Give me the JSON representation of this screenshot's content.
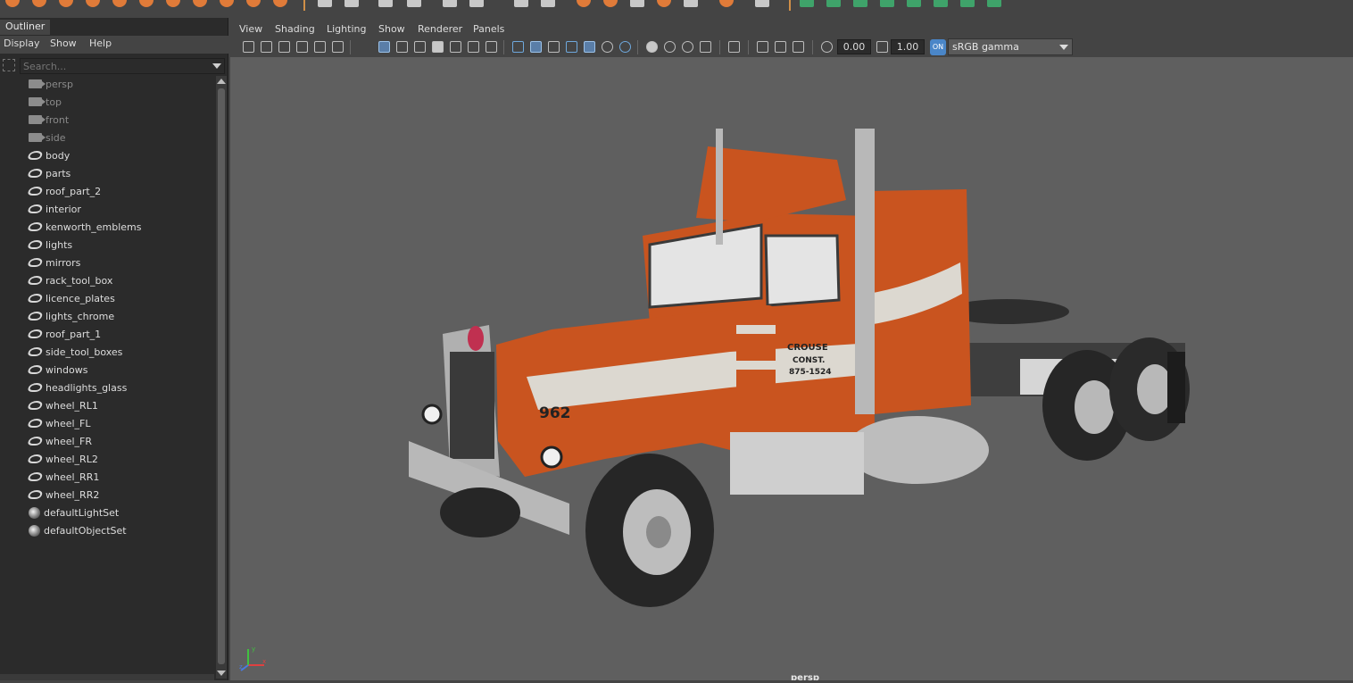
{
  "outliner": {
    "tab": "Outliner",
    "menu": [
      "Display",
      "Show",
      "Help"
    ],
    "search": {
      "placeholder": "Search..."
    },
    "items": [
      {
        "label": "persp",
        "icon": "camera-icon",
        "dim": true
      },
      {
        "label": "top",
        "icon": "camera-icon",
        "dim": true
      },
      {
        "label": "front",
        "icon": "camera-icon",
        "dim": true
      },
      {
        "label": "side",
        "icon": "camera-icon",
        "dim": true
      },
      {
        "label": "body",
        "icon": "mesh-group-icon"
      },
      {
        "label": "parts",
        "icon": "mesh-group-icon"
      },
      {
        "label": "roof_part_2",
        "icon": "mesh-group-icon"
      },
      {
        "label": "interior",
        "icon": "mesh-group-icon"
      },
      {
        "label": "kenworth_emblems",
        "icon": "mesh-group-icon"
      },
      {
        "label": "lights",
        "icon": "mesh-group-icon"
      },
      {
        "label": "mirrors",
        "icon": "mesh-group-icon"
      },
      {
        "label": "rack_tool_box",
        "icon": "mesh-group-icon"
      },
      {
        "label": "licence_plates",
        "icon": "mesh-group-icon"
      },
      {
        "label": "lights_chrome",
        "icon": "mesh-group-icon"
      },
      {
        "label": "roof_part_1",
        "icon": "mesh-group-icon"
      },
      {
        "label": "side_tool_boxes",
        "icon": "mesh-group-icon"
      },
      {
        "label": "windows",
        "icon": "mesh-group-icon"
      },
      {
        "label": "headlights_glass",
        "icon": "mesh-group-icon"
      },
      {
        "label": "wheel_RL1",
        "icon": "mesh-group-icon"
      },
      {
        "label": "wheel_FL",
        "icon": "mesh-group-icon"
      },
      {
        "label": "wheel_FR",
        "icon": "mesh-group-icon"
      },
      {
        "label": "wheel_RL2",
        "icon": "mesh-group-icon"
      },
      {
        "label": "wheel_RR1",
        "icon": "mesh-group-icon"
      },
      {
        "label": "wheel_RR2",
        "icon": "mesh-group-icon"
      },
      {
        "label": "defaultLightSet",
        "icon": "set-icon"
      },
      {
        "label": "defaultObjectSet",
        "icon": "set-icon"
      }
    ]
  },
  "viewport": {
    "menu": [
      "View",
      "Shading",
      "Lighting",
      "Show",
      "Renderer",
      "Panels"
    ],
    "exposure": "0.00",
    "gamma": "1.00",
    "colorspace": "sRGB gamma",
    "camera": "persp",
    "truck": {
      "cab_text": [
        "CROUSE",
        "CONST.",
        "875-1524"
      ],
      "hood_number": "962"
    },
    "colors": {
      "paint": "#c9541f",
      "stripe": "#dcd8d0",
      "chrome": "#b8b8b8",
      "tire": "#262626",
      "background": "#5f5f5f"
    }
  }
}
